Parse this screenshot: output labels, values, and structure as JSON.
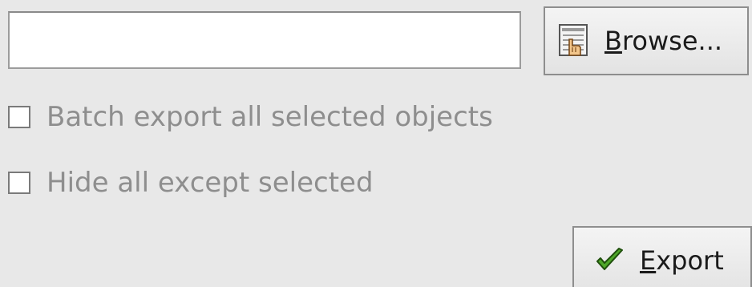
{
  "export_panel": {
    "filename_input": {
      "value": "",
      "placeholder": ""
    },
    "browse_button": {
      "label_mnemonic": "B",
      "label_rest": "rowse...",
      "icon": "file-browse-icon"
    },
    "batch_export_checkbox": {
      "label": "Batch export all selected objects",
      "checked": false
    },
    "hide_except_checkbox": {
      "label": "Hide all except selected",
      "checked": false
    },
    "export_button": {
      "label_mnemonic": "E",
      "label_rest": "xport",
      "icon": "checkmark-icon"
    }
  }
}
